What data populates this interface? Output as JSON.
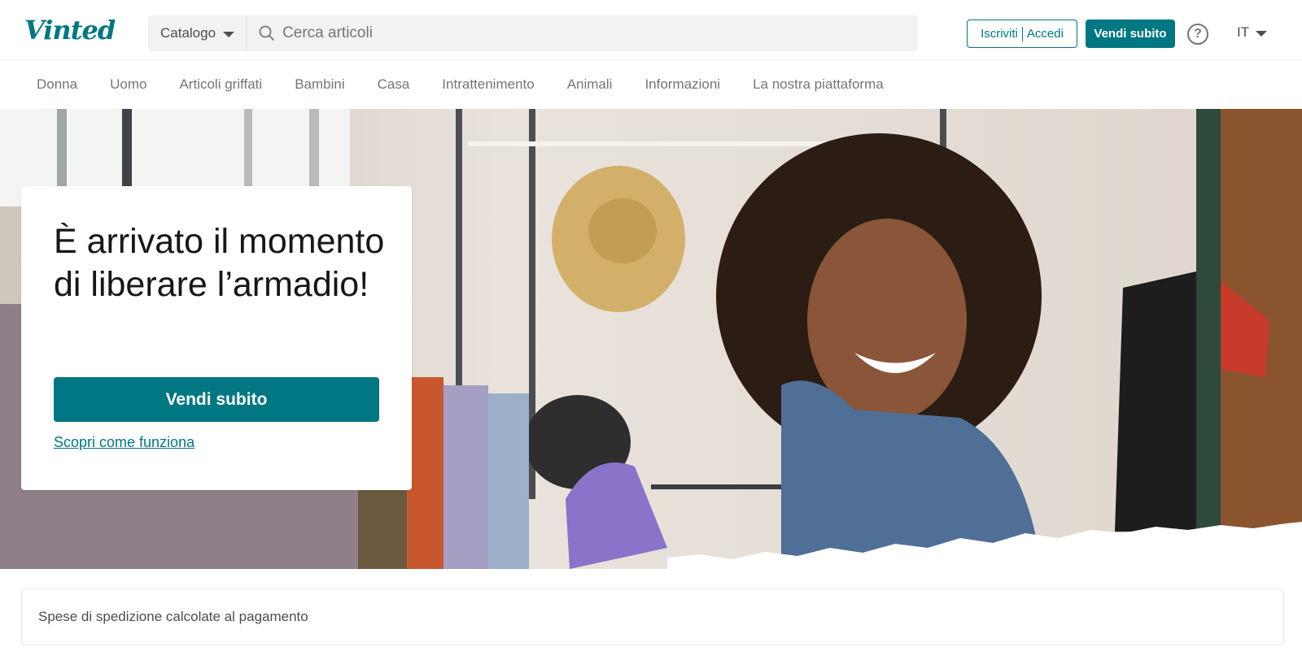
{
  "header": {
    "logo": "Vinted",
    "catalog_label": "Catalogo",
    "search_placeholder": "Cerca articoli",
    "signup_label": "Iscriviti",
    "login_label": "Accedi",
    "sell_label": "Vendi subito",
    "help_symbol": "?",
    "language": "IT"
  },
  "nav": {
    "items": [
      {
        "label": "Donna"
      },
      {
        "label": "Uomo"
      },
      {
        "label": "Articoli griffati"
      },
      {
        "label": "Bambini"
      },
      {
        "label": "Casa"
      },
      {
        "label": "Intrattenimento"
      },
      {
        "label": "Animali"
      },
      {
        "label": "Informazioni"
      },
      {
        "label": "La nostra piattaforma"
      }
    ]
  },
  "hero": {
    "title": "È arrivato il momento di liberare l’armadio!",
    "cta_label": "Vendi subito",
    "link_label": "Scopri come funziona"
  },
  "shipping": {
    "text": "Spese di spedizione calcolate al pagamento"
  },
  "colors": {
    "brand": "#007782",
    "nav_text": "#757575"
  }
}
